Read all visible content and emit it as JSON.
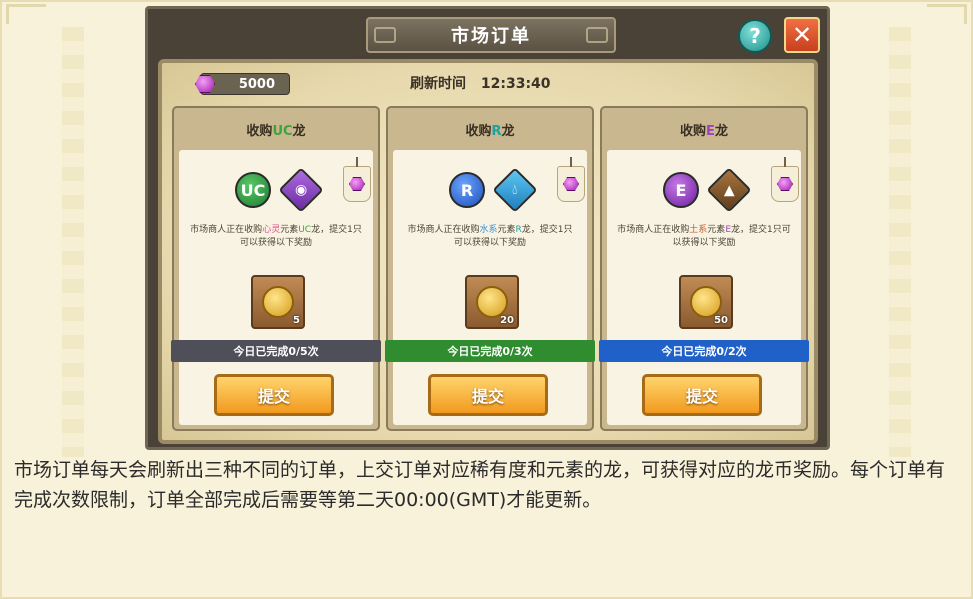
{
  "window": {
    "title": "市场订单",
    "help_label": "?",
    "close_label": "✕"
  },
  "header": {
    "currency_amount": "5000",
    "refresh_label": "刷新时间",
    "refresh_time": "12:33:40"
  },
  "cards": [
    {
      "title_pre": "收购",
      "title_code": "UC",
      "title_post": "龙",
      "rarity": "UC",
      "element_icon": "mind-eye-icon",
      "desc_1": "市场商人正在收购",
      "desc_elem": "心灵",
      "desc_2": "元素",
      "desc_code": "UC",
      "desc_3": "龙，提交1只可以获得以下奖励",
      "reward_qty": "5",
      "progress": "今日已完成0/5次",
      "submit": "提交"
    },
    {
      "title_pre": "收购",
      "title_code": "R",
      "title_post": "龙",
      "rarity": "R",
      "element_icon": "water-drop-icon",
      "desc_1": "市场商人正在收购",
      "desc_elem": "水系",
      "desc_2": "元素",
      "desc_code": "R",
      "desc_3": "龙，提交1只可以获得以下奖励",
      "reward_qty": "20",
      "progress": "今日已完成0/3次",
      "submit": "提交"
    },
    {
      "title_pre": "收购",
      "title_code": "E",
      "title_post": "龙",
      "rarity": "E",
      "element_icon": "mountain-icon",
      "desc_1": "市场商人正在收购",
      "desc_elem": "土系",
      "desc_2": "元素",
      "desc_code": "E",
      "desc_3": "龙，提交1只可以获得以下奖励",
      "reward_qty": "50",
      "progress": "今日已完成0/2次",
      "submit": "提交"
    }
  ],
  "caption": "市场订单每天会刷新出三种不同的订单，上交订单对应稀有度和元素的龙，可获得对应的龙币奖励。每个订单有完成次数限制，订单全部完成后需要等第二天00:00(GMT)才能更新。"
}
